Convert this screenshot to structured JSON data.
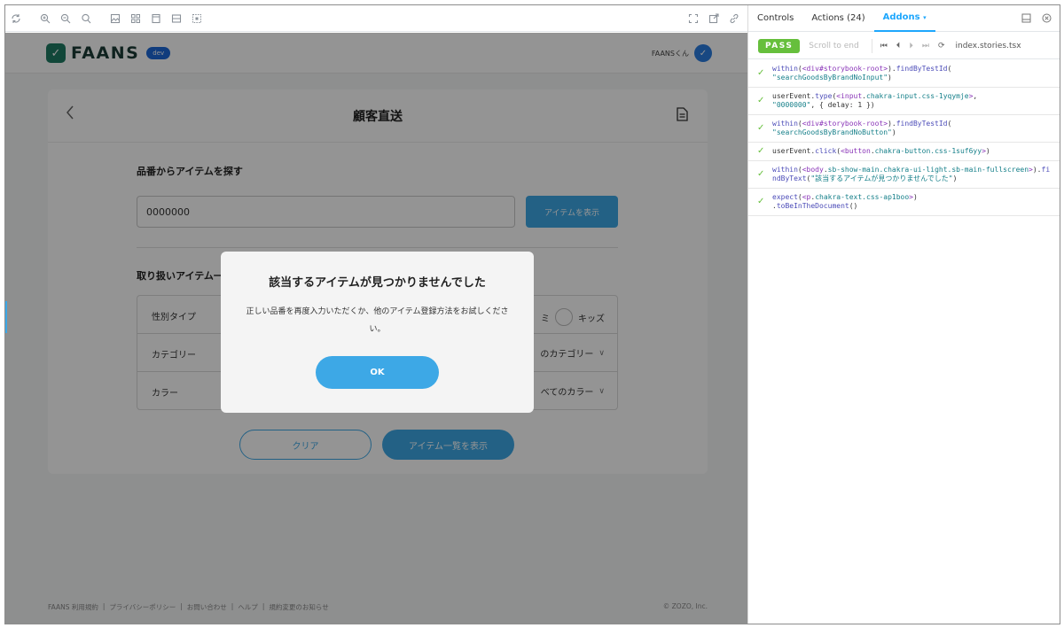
{
  "preview": {
    "toolbar_icons": [
      "reload-icon",
      "zoom-in-icon",
      "zoom-out-icon",
      "zoom-reset-icon",
      "background-icon",
      "grid-icon",
      "viewport-icon",
      "measure-icon",
      "outline-icon",
      "fullscreen-icon",
      "new-tab-icon",
      "copy-link-icon"
    ],
    "app": {
      "logo_text": "FAANS",
      "dev_badge": "dev",
      "user_name": "FAANSくん",
      "page_title": "顧客直送",
      "search_section_title": "品番からアイテムを探す",
      "search_value": "0000000",
      "show_item_button": "アイテムを表示",
      "handled_section_title": "取り扱いアイテム一",
      "filters": [
        {
          "label": "性別タイプ",
          "right": "キッズ",
          "right_prefix": "ミ"
        },
        {
          "label": "カテゴリー",
          "right": "のカテゴリー"
        },
        {
          "label": "カラー",
          "right": "べてのカラー"
        }
      ],
      "clear_button": "クリア",
      "list_button": "アイテム一覧を表示",
      "footer_links": [
        "FAANS 利用規約",
        "|",
        "プライバシーポリシー",
        "|",
        "お問い合わせ",
        "|",
        "ヘルプ",
        "|",
        "規約変更のお知らせ"
      ],
      "copyright": "© ZOZO, Inc."
    },
    "dialog": {
      "title": "該当するアイテムが見つかりませんでした",
      "body": "正しい品番を再度入力いただくか、他のアイテム登録方法をお試しください。",
      "ok_button": "OK"
    }
  },
  "panel": {
    "tabs": [
      "Controls",
      "Actions (24)",
      "Addons"
    ],
    "active_tab": "Addons",
    "status": "PASS",
    "scroll_to_end": "Scroll to end",
    "file_name": "index.stories.tsx",
    "steps": [
      {
        "parts": [
          [
            "fn",
            "within"
          ],
          [
            "p",
            "("
          ],
          [
            "el",
            "<div#storybook-root>"
          ],
          [
            "p",
            ")."
          ],
          [
            "fn",
            "findByTestId"
          ],
          [
            "p",
            "(\n"
          ],
          [
            "str",
            "\"searchGoodsByBrandNoInput\""
          ],
          [
            "p",
            ")"
          ]
        ]
      },
      {
        "parts": [
          [
            "p",
            "userEvent."
          ],
          [
            "fn",
            "type"
          ],
          [
            "p",
            "("
          ],
          [
            "el",
            "<input"
          ],
          [
            "p",
            "."
          ],
          [
            "str",
            "chakra-input.css-1yqymje"
          ],
          [
            "el",
            ">"
          ],
          [
            "p",
            ",\n"
          ],
          [
            "str",
            "\"0000000\""
          ],
          [
            "p",
            ", { delay: 1 })"
          ]
        ]
      },
      {
        "parts": [
          [
            "fn",
            "within"
          ],
          [
            "p",
            "("
          ],
          [
            "el",
            "<div#storybook-root>"
          ],
          [
            "p",
            ")."
          ],
          [
            "fn",
            "findByTestId"
          ],
          [
            "p",
            "(\n"
          ],
          [
            "str",
            "\"searchGoodsByBrandNoButton\""
          ],
          [
            "p",
            ")"
          ]
        ]
      },
      {
        "parts": [
          [
            "p",
            "userEvent."
          ],
          [
            "fn",
            "click"
          ],
          [
            "p",
            "("
          ],
          [
            "el",
            "<button"
          ],
          [
            "p",
            "."
          ],
          [
            "str",
            "chakra-button.css-1suf6yy"
          ],
          [
            "el",
            ">"
          ],
          [
            "p",
            ")"
          ]
        ]
      },
      {
        "parts": [
          [
            "fn",
            "within"
          ],
          [
            "p",
            "("
          ],
          [
            "el",
            "<body"
          ],
          [
            "p",
            "."
          ],
          [
            "str",
            "sb-show-main.chakra-ui-light.sb-main-fullscreen"
          ],
          [
            "el",
            ">"
          ],
          [
            "p",
            ")."
          ],
          [
            "fn",
            "findByText"
          ],
          [
            "p",
            "("
          ],
          [
            "str",
            "\"該当するアイテムが見つかりませんでした\""
          ],
          [
            "p",
            ")"
          ]
        ]
      },
      {
        "parts": [
          [
            "fn",
            "expect"
          ],
          [
            "p",
            "("
          ],
          [
            "el",
            "<p"
          ],
          [
            "p",
            "."
          ],
          [
            "str",
            "chakra-text.css-ap1boo"
          ],
          [
            "el",
            ">"
          ],
          [
            "p",
            ")\n."
          ],
          [
            "fn",
            "toBeInTheDocument"
          ],
          [
            "p",
            "()"
          ]
        ]
      }
    ]
  }
}
